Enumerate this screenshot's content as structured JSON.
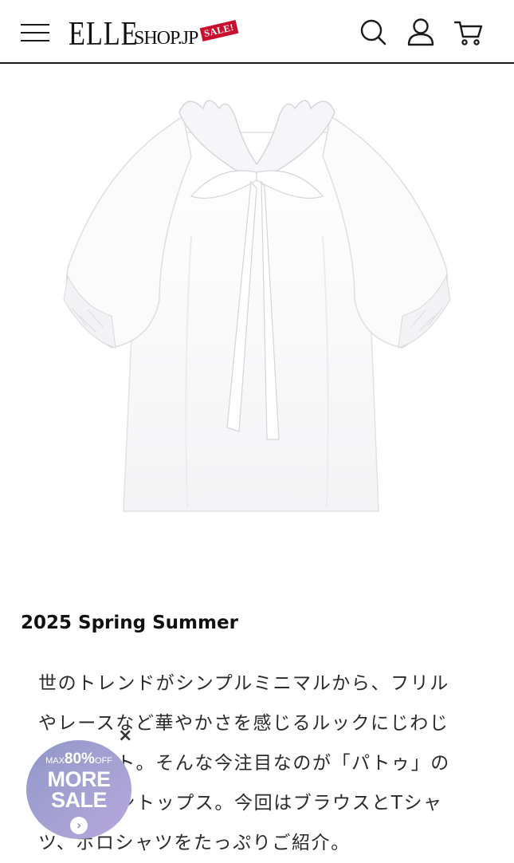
{
  "header": {
    "logo": {
      "elle": "ELLE",
      "shop": "SHOP.JP",
      "sale_tag": "SALE!"
    },
    "icons": [
      "menu-icon",
      "search-icon",
      "user-icon",
      "cart-icon"
    ]
  },
  "product": {
    "image_alt": "white puff-sleeve ruffle collar blouse with tie"
  },
  "article": {
    "title": "2025 Spring Summer",
    "body": "世のトレンドがシンプルミニマルから、フリルやレースなど華やかさを感じるルックにじわじわとシフト。そんな今注目なのが「パトゥ」のフェミニントップス。今回はブラウスとTシャツ、ポロシャツをたっぷりご紹介。"
  },
  "sale_badge": {
    "max_label": "MAX",
    "percent": "80%",
    "off_label": "OFF",
    "line_more": "MORE",
    "line_sale": "SALE",
    "arrow": "›",
    "close": "×",
    "colors": {
      "from": "#8f97c7",
      "to": "#b7a6dd"
    }
  }
}
